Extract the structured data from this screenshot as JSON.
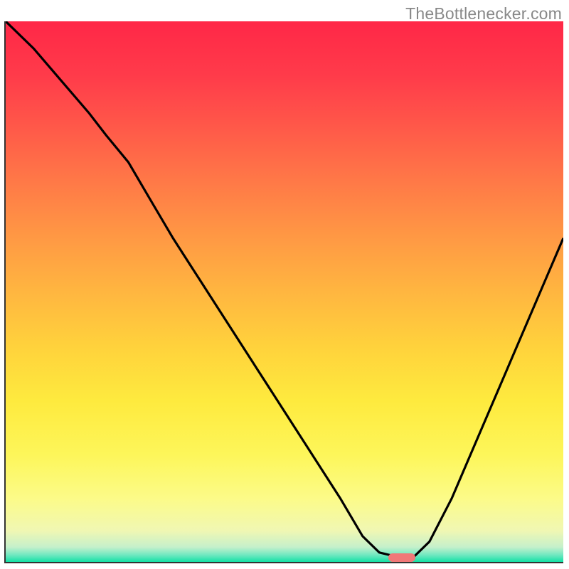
{
  "attribution": "TheBottlenecker.com",
  "colors": {
    "gradient_top": "#ff2747",
    "gradient_bottom": "#00df9f",
    "curve": "#000000",
    "axis": "#333333",
    "marker": "#f07878",
    "attribution_text": "#888888"
  },
  "chart_data": {
    "type": "line",
    "title": "",
    "xlabel": "",
    "ylabel": "",
    "xlim": [
      0,
      100
    ],
    "ylim": [
      0,
      100
    ],
    "legend": false,
    "grid": false,
    "series": [
      {
        "name": "bottleneck-curve",
        "x": [
          0,
          5,
          10,
          15,
          18,
          22,
          26,
          30,
          35,
          40,
          45,
          50,
          55,
          60,
          64,
          67,
          71,
          73,
          76,
          80,
          85,
          90,
          95,
          100
        ],
        "values": [
          100,
          95,
          89,
          83,
          79,
          74,
          67,
          60,
          52,
          44,
          36,
          28,
          20,
          12,
          5,
          2,
          1,
          1,
          4,
          12,
          24,
          36,
          48,
          60
        ]
      }
    ],
    "annotations": [
      {
        "name": "optimal-marker",
        "x": 71,
        "y": 1
      }
    ],
    "description": "V-shaped bottleneck curve over a red-to-green vertical gradient. Curve descends steeply from top-left (100%) with a slight knee around x≈18, reaches a flat minimum near x≈67–73 (≈1%), then rises linearly toward x=100 (≈60%). A small rounded pink marker sits at the trough on the baseline."
  }
}
